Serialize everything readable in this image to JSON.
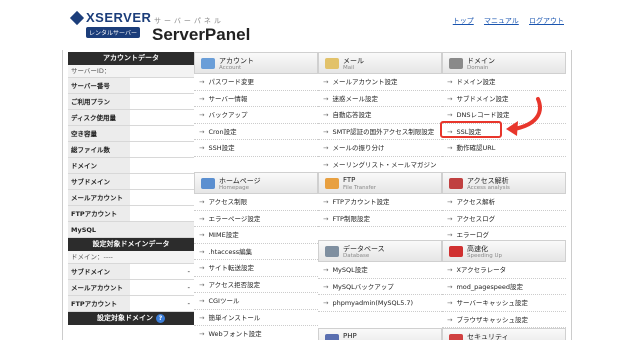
{
  "header": {
    "brand": "XSERVER",
    "brand_sub": "レンタルサーバー",
    "kana": "サーバーパネル",
    "product": "ServerPanel",
    "links": [
      "トップ",
      "マニュアル",
      "ログアウト"
    ]
  },
  "sidebar": {
    "account_title": "アカウントデータ",
    "server_id_label": "サーバーID：",
    "account_rows": [
      "サーバー番号",
      "ご利用プラン",
      "ディスク使用量",
      "空き容量",
      "総ファイル数",
      "ドメイン",
      "サブドメイン",
      "メールアカウント",
      "FTPアカウント",
      "MySQL"
    ],
    "domain_title": "設定対象ドメインデータ",
    "domain_sub": "ドメイン：----",
    "domain_rows": [
      {
        "label": "サブドメイン",
        "value": "-"
      },
      {
        "label": "メールアカウント",
        "value": "-"
      },
      {
        "label": "FTPアカウント",
        "value": "-"
      }
    ],
    "target_title": "設定対象ドメイン",
    "help": "?"
  },
  "sections": {
    "account": {
      "title": "アカウント",
      "en": "Account",
      "color": "#6a9ed8",
      "items": [
        "パスワード変更",
        "サーバー情報",
        "バックアップ",
        "Cron設定",
        "SSH設定"
      ]
    },
    "mail": {
      "title": "メール",
      "en": "Mail",
      "color": "#e2c26a",
      "items": [
        "メールアカウント設定",
        "迷惑メール設定",
        "自動応答設定",
        "SMTP認証の国外アクセス制限設定",
        "メールの振り分け",
        "メーリングリスト・メールマガジン"
      ]
    },
    "domain": {
      "title": "ドメイン",
      "en": "Domain",
      "color": "#8a8a8a",
      "items": [
        "ドメイン設定",
        "サブドメイン設定",
        "DNSレコード設定",
        "SSL設定",
        "動作確認URL"
      ]
    },
    "homepage": {
      "title": "ホームページ",
      "en": "Homepage",
      "color": "#5b8fd0",
      "items": [
        "アクセス制限",
        "エラーページ設定",
        "MIME設定",
        ".htaccess編集",
        "サイト転送設定",
        "アクセス拒否設定",
        "CGIツール",
        "簡単インストール",
        "Webフォント設定"
      ]
    },
    "ftp": {
      "title": "FTP",
      "en": "File Transfer",
      "color": "#e8a040",
      "items": [
        "FTPアカウント設定",
        "FTP制限設定"
      ]
    },
    "database": {
      "title": "データベース",
      "en": "Database",
      "color": "#7f8fa0",
      "items": [
        "MySQL設定",
        "MySQLバックアップ",
        "phpmyadmin(MySQL5.7)"
      ]
    },
    "access": {
      "title": "アクセス解析",
      "en": "Access analysis",
      "color": "#c04040",
      "items": [
        "アクセス解析",
        "アクセスログ",
        "エラーログ"
      ]
    },
    "speed": {
      "title": "高速化",
      "en": "Speeding Up",
      "color": "#d03030",
      "items": [
        "Xアクセラレータ",
        "mod_pagespeed設定",
        "サーバーキャッシュ設定",
        "ブラウザキャッシュ設定"
      ]
    },
    "php": {
      "title": "PHP",
      "en": "",
      "color": "#5a6fb0",
      "items": []
    },
    "security": {
      "title": "セキュリティ",
      "en": "",
      "color": "#d04040",
      "items": []
    }
  }
}
